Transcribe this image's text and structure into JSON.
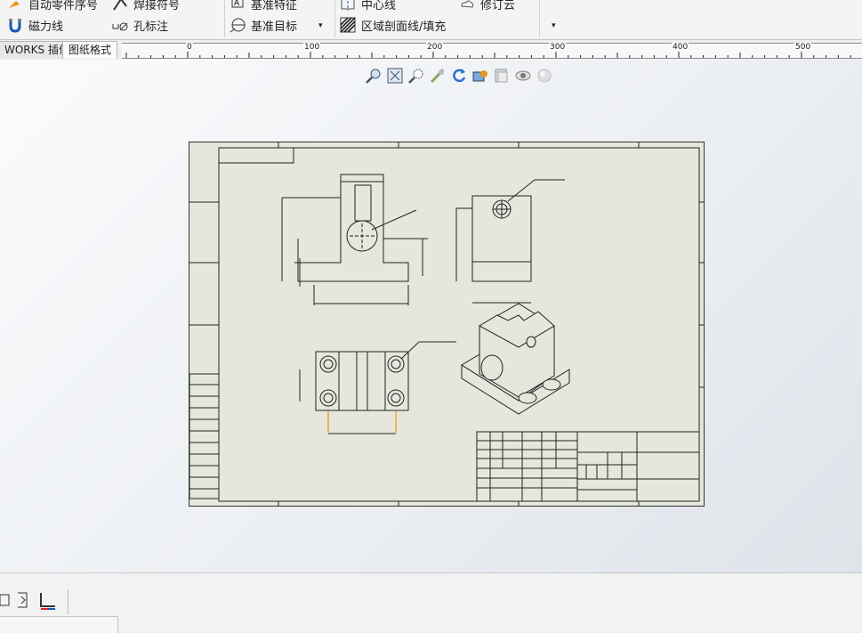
{
  "toolbar": {
    "items": [
      {
        "label": "自动零件序号",
        "icon": "auto-balloon-icon"
      },
      {
        "label": "焊接符号",
        "icon": "weld-symbol-icon"
      },
      {
        "label": "基准特征",
        "icon": "datum-feature-icon"
      },
      {
        "label": "中心线",
        "icon": "centerline-icon"
      },
      {
        "label": "修订云",
        "icon": "revision-cloud-icon"
      },
      {
        "label": "磁力线",
        "icon": "magnetic-line-icon"
      },
      {
        "label": "孔标注",
        "icon": "hole-callout-icon"
      },
      {
        "label": "基准目标",
        "icon": "datum-target-icon"
      },
      {
        "label": "区域剖面线/填充",
        "icon": "area-hatch-icon"
      }
    ]
  },
  "tabs": [
    {
      "label": "WORKS 插件",
      "active": false
    },
    {
      "label": "图纸格式",
      "active": true
    }
  ],
  "ruler": {
    "labels": [
      "0",
      "100",
      "200",
      "300",
      "400",
      "500"
    ]
  },
  "view_toolbar": {
    "icons": [
      "zoom-to-fit-icon",
      "zoom-to-area-icon",
      "zoom-in-out-icon",
      "pan-icon",
      "rotate-icon",
      "section-view-icon",
      "display-style-icon",
      "hide-show-icon",
      "appearance-icon"
    ]
  },
  "colors": {
    "sheet": "#e7e6dc",
    "accent_orange": "#e8961e",
    "line": "#222222"
  }
}
